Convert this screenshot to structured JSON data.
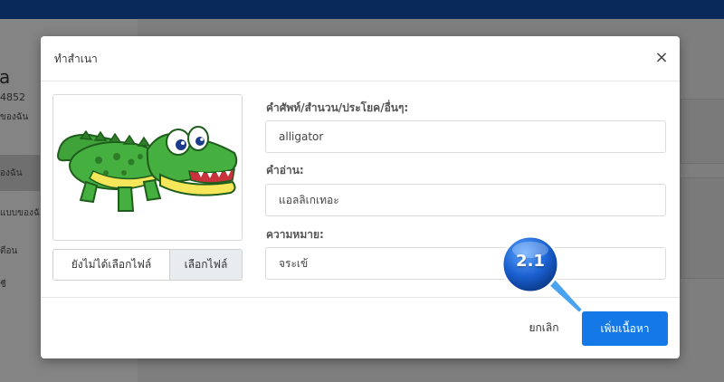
{
  "background": {
    "user_name": "a",
    "user_id": "4852",
    "nav_items": [
      "ของฉัน",
      "องฉัน",
      "แบบของฉั",
      "ตือน",
      "ชี"
    ]
  },
  "modal": {
    "title": "ทำสำเนา",
    "close_icon": "×",
    "image_alt": "crocodile cartoon",
    "file_status": "ยังไม่ได้เลือกไฟล์",
    "file_button": "เลือกไฟล์",
    "fields": {
      "word_label": "คำศัพท์/สำนวน/ประโยค/อื่นๆ:",
      "word_value": "alligator",
      "reading_label": "คำอ่าน:",
      "reading_value": "แอลลิเกเทอะ",
      "meaning_label": "ความหมาย:",
      "meaning_value": "จระเข้"
    },
    "cancel_label": "ยกเลิก",
    "submit_label": "เพิ่มเนื้อหา"
  },
  "callout": {
    "label": "2.1"
  },
  "colors": {
    "topbar": "#08295a",
    "primary_button": "#1479e6",
    "callout_blue": "#1a5fd0"
  }
}
